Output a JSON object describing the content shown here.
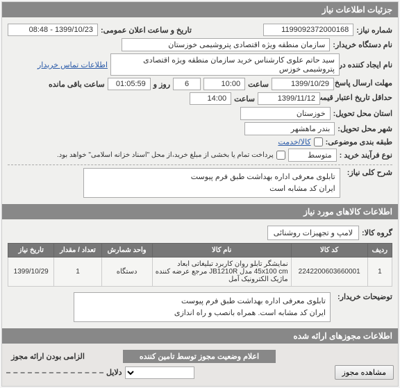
{
  "header": {
    "title": "جزئیات اطلاعات نیاز"
  },
  "info": {
    "req_no_label": "شماره نیاز:",
    "req_no": "1199092372000168",
    "pubdate_label": "تاریخ و ساعت اعلان عمومی:",
    "pubdate": "1399/10/23 - 08:48",
    "buyer_org_label": "نام دستگاه خریدار:",
    "buyer_org": "سازمان منطقه ویژه اقتصادی پتروشیمی خوزستان",
    "creator_label": "نام ایجاد کننده درخواست:",
    "creator": "سید حاتم علوی کارشناس خرید سازمان منطقه ویژه اقتصادی پتروشیمی خوزس",
    "contact_link": "اطلاعات تماس خریدار",
    "deadline_label": "مهلت ارسال پاسخ: تا تاریخ:",
    "deadline_date": "1399/10/29",
    "time_lbl": "ساعت",
    "deadline_time": "10:00",
    "days_remaining": "6",
    "day_and": "روز و",
    "countdown": "01:05:59",
    "remain_lbl": "ساعت باقی مانده",
    "valid_label": "حداقل تاریخ اعتبار قیمت: تا تاریخ:",
    "valid_date": "1399/11/12",
    "valid_time": "14:00",
    "province_label": "استان محل تحویل:",
    "province": "خوزستان",
    "city_label": "شهر محل تحویل:",
    "city": "بندر ماهشهر",
    "cat_label": "طبقه بندی موضوعی:",
    "cat_link": "کالا/خدمت",
    "proc_label": "نوع فرآیند خرید :",
    "proc": "متوسط",
    "proc_note": "پرداخت تمام یا بخشی از مبلغ خرید،از محل \"اسناد خزانه اسلامی\" خواهد بود.",
    "desc_label": "شرح کلی نیاز:",
    "desc_l1": "تابلوی معرفی اداره بهداشت طبق فرم پیوست",
    "desc_l2": "ایران کد مشابه است"
  },
  "items": {
    "header": "اطلاعات کالاهای مورد نیاز",
    "group_label": "گروه کالا:",
    "group_value": "لامپ و تجهیزات روشنائی",
    "cols": {
      "idx": "ردیف",
      "code": "کد کالا",
      "name": "نام کالا",
      "unit": "واحد شمارش",
      "qty": "تعداد / مقدار",
      "date": "تاریخ نیاز"
    },
    "rows": [
      {
        "idx": "1",
        "code": "2242200603660001",
        "name": "نمایشگر تابلو روان کاربرد تبلیغاتی ابعاد 45x100 cm مدل JB1210R مرجع عرضه کننده ماژیک الکترونیک آمل",
        "unit": "دستگاه",
        "qty": "1",
        "date": "1399/10/29"
      }
    ]
  },
  "buyer_notes": {
    "label": "توضیحات خریدار:",
    "l1": "تابلوی معرفی اداره بهداشت طبق فرم پیوست",
    "l2": "ایران کد مشابه است.    همراه بانصب و راه اندازی"
  },
  "authz": {
    "header": "اطلاعات مجوزهای ارائه شده",
    "view_btn": "مشاهده مجوز",
    "status_hdr": "اعلام وضعیت مجوز توسط تامین کننده",
    "reason_lbl": "دلایل",
    "mandatory_lbl": "الزامی بودن ارائه مجوز"
  }
}
